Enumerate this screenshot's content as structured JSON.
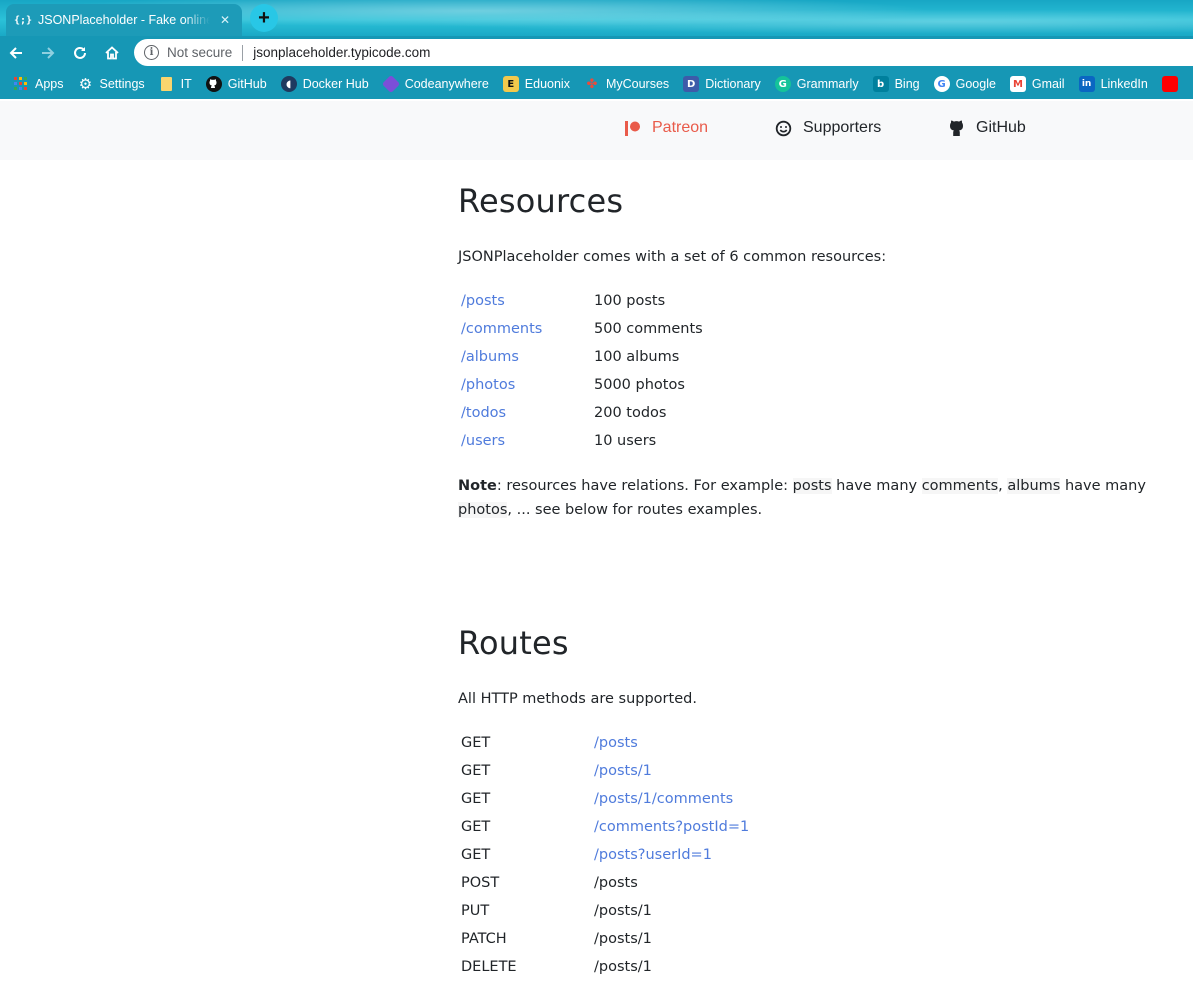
{
  "browser": {
    "tab": {
      "title": "JSONPlaceholder - Fake online R",
      "favicon": "{;}"
    },
    "new_tab_symbol": "+",
    "security_label": "Not secure",
    "url": "jsonplaceholder.typicode.com",
    "bookmarks": [
      {
        "label": "Apps",
        "icon": "apps-icon",
        "color": "#ea4335"
      },
      {
        "label": "Settings",
        "icon": "gear-icon",
        "color": "#ffffff"
      },
      {
        "label": "IT",
        "icon": "folder-icon",
        "color": "#f9d56e"
      },
      {
        "label": "GitHub",
        "icon": "github-icon",
        "color": "#000000"
      },
      {
        "label": "Docker Hub",
        "icon": "docker-icon",
        "color": "#1e3a5f"
      },
      {
        "label": "Codeanywhere",
        "icon": "codeanywhere-icon",
        "color": "#7b4fd8"
      },
      {
        "label": "Eduonix",
        "icon": "eduonix-icon",
        "color": "#f2c94c"
      },
      {
        "label": "MyCourses",
        "icon": "mycourses-icon",
        "color": "#e84c3d"
      },
      {
        "label": "Dictionary",
        "icon": "dictionary-icon",
        "color": "#3d5ba9"
      },
      {
        "label": "Grammarly",
        "icon": "grammarly-icon",
        "color": "#15c39a"
      },
      {
        "label": "Bing",
        "icon": "bing-icon",
        "color": "#00809d"
      },
      {
        "label": "Google",
        "icon": "google-icon",
        "color": "#ffffff"
      },
      {
        "label": "Gmail",
        "icon": "gmail-icon",
        "color": "#ea4335"
      },
      {
        "label": "LinkedIn",
        "icon": "linkedin-icon",
        "color": "#0a66c2"
      }
    ]
  },
  "site_nav": {
    "patreon": "Patreon",
    "supporters": "Supporters",
    "github": "GitHub",
    "patreon_color": "#e95b4a"
  },
  "resources": {
    "title": "Resources",
    "lead": "JSONPlaceholder comes with a set of 6 common resources:",
    "rows": [
      {
        "path": "/posts",
        "count": "100 posts"
      },
      {
        "path": "/comments",
        "count": "500 comments"
      },
      {
        "path": "/albums",
        "count": "100 albums"
      },
      {
        "path": "/photos",
        "count": "5000 photos"
      },
      {
        "path": "/todos",
        "count": "200 todos"
      },
      {
        "path": "/users",
        "count": "10 users"
      }
    ],
    "note": {
      "bold": "Note",
      "t1": ": resources have relations. For example: ",
      "c1": "posts",
      "t2": " have many ",
      "c2": "comments",
      "t3": ", ",
      "c3": "albums",
      "t4": " have many ",
      "c4": "photos",
      "t5": ", ... see below for routes examples."
    }
  },
  "routes": {
    "title": "Routes",
    "lead": "All HTTP methods are supported.",
    "rows": [
      {
        "method": "GET",
        "path": "/posts",
        "link": true
      },
      {
        "method": "GET",
        "path": "/posts/1",
        "link": true
      },
      {
        "method": "GET",
        "path": "/posts/1/comments",
        "link": true
      },
      {
        "method": "GET",
        "path": "/comments?postId=1",
        "link": true
      },
      {
        "method": "GET",
        "path": "/posts?userId=1",
        "link": true
      },
      {
        "method": "POST",
        "path": "/posts",
        "link": false
      },
      {
        "method": "PUT",
        "path": "/posts/1",
        "link": false
      },
      {
        "method": "PATCH",
        "path": "/posts/1",
        "link": false
      },
      {
        "method": "DELETE",
        "path": "/posts/1",
        "link": false
      }
    ]
  },
  "colors": {
    "link": "#4f7bdc",
    "chrome_bar": "#1697b5",
    "navbar_bg": "#f8f9fa"
  }
}
